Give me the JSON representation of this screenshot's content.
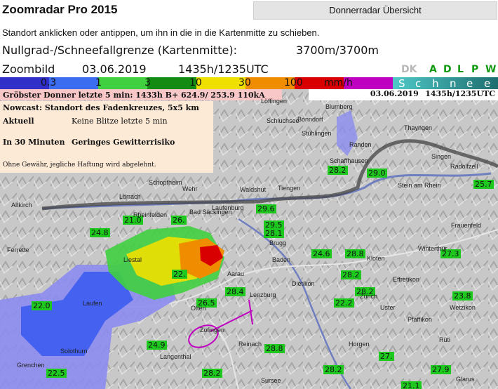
{
  "header": {
    "title": "Zoomradar Pro 2015",
    "overview_button": "Donnerradar Übersicht",
    "instruction": "Standort anklicken oder antippen, um ihn in die in die Kartenmitte zu schieben.",
    "freezing_label": "Nullgrad-/Schneefallgrenze (Kartenmitte):",
    "freezing_value": "3700m/3700m",
    "zoom_label": "Zoombild",
    "date": "03.06.2019",
    "time": "1435h/1235UTC"
  },
  "modes": [
    "DK",
    "A",
    "D",
    "L",
    "P",
    "W"
  ],
  "legend": {
    "ticks": [
      "0.3",
      "1",
      "3",
      "10",
      "30",
      "100"
    ],
    "unit": "mm/h",
    "snow_letters": [
      "S",
      "c",
      "h",
      "n",
      "e",
      "e"
    ],
    "colors": [
      "#3030c8",
      "#3c6cf0",
      "#40d040",
      "#148c14",
      "#f0e000",
      "#f08c00",
      "#d80000",
      "#c000c0"
    ]
  },
  "map": {
    "lightning_info": "Gröbster Donner letzte 5 min: 1433h B+ 624.9/ 253.9 110kA",
    "map_date": "03.06.2019",
    "map_time": "1435h/1235UTC",
    "nowcast_title": "Nowcast: Standort des Fadenkreuzes, 5x5 km",
    "current_label": "Aktuell",
    "current_value": "Keine Blitze letzte 5 min",
    "in30_label": "In 30 Minuten",
    "in30_value": "Geringes Gewitterrisiko",
    "disclaimer": "Ohne Gewähr, jegliche Haftung wird abgelehnt.",
    "stations": [
      "21.0",
      "26.",
      "24.8",
      "29.6",
      "29.5",
      "28.1",
      "28.2",
      "29.0",
      "25.7",
      "24.6",
      "28.8",
      "27.3",
      "28.2",
      "22.0",
      "22.",
      "28.4",
      "26.5",
      "22.2",
      "28.2",
      "23.8",
      "24.9",
      "28.8",
      "27.",
      "27.9",
      "22.5",
      "28.2",
      "28.2",
      "21.1"
    ],
    "places": [
      "Löffingen",
      "Blumberg",
      "Schluchsee",
      "Bonndorf",
      "Stühlingen",
      "Randen",
      "Thayngen",
      "Schaffhausen",
      "Singen",
      "Radolfzell",
      "Stein am Rhein",
      "Frauenfeld",
      "Waldshut",
      "Tiengen",
      "Laufenburg",
      "Bad Säckingen",
      "Rheinfelden",
      "Lörrach",
      "Schopfheim",
      "Wehr",
      "Brugg",
      "Baden",
      "Kloten",
      "Winterthur",
      "Dietikon",
      "Effretikon",
      "Aarau",
      "Lenzburg",
      "Olten",
      "Zofingen",
      "Reinach",
      "Langenthal",
      "Solothurn",
      "Grenchen",
      "Horgen",
      "Wetzikon",
      "Rüti",
      "Zürich",
      "Pfäffikon",
      "Uster",
      "Altkirch",
      "Ferrette",
      "Liestal",
      "Laufen",
      "Sursee",
      "Glarus"
    ]
  }
}
